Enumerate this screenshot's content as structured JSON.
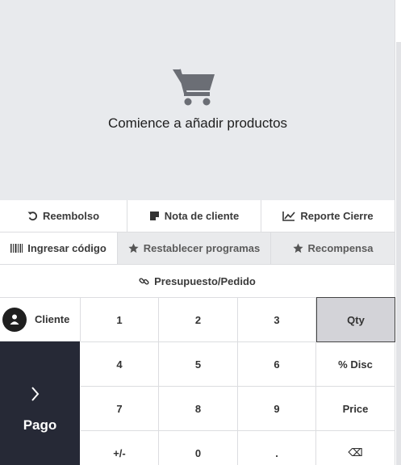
{
  "empty_state": {
    "icon": "shopping-cart-icon",
    "message": "Comience a añadir productos"
  },
  "actions_row1": [
    {
      "label": "Reembolso",
      "icon": "undo-icon"
    },
    {
      "label": "Nota de cliente",
      "icon": "note-icon"
    },
    {
      "label": "Reporte Cierre",
      "icon": "chart-line-icon"
    }
  ],
  "actions_row2": [
    {
      "label": "Ingresar código",
      "icon": "barcode-icon"
    },
    {
      "label": "Restablecer programas",
      "icon": "star-icon"
    },
    {
      "label": "Recompensa",
      "icon": "star-icon"
    }
  ],
  "quotation": {
    "label": "Presupuesto/Pedido",
    "icon": "link-icon"
  },
  "customer": {
    "label": "Cliente",
    "icon": "user-icon"
  },
  "payment": {
    "label": "Pago",
    "icon": "chevron-right-icon"
  },
  "numpad": {
    "keys": [
      "1",
      "2",
      "3",
      "Qty",
      "4",
      "5",
      "6",
      "% Disc",
      "7",
      "8",
      "9",
      "Price",
      "+/-",
      "0",
      ".",
      "⌫"
    ],
    "active_mode": "Qty"
  },
  "colors": {
    "pay_bg": "#262936",
    "empty_bg": "#e8eaed",
    "active_key_bg": "#d3d3d8"
  }
}
